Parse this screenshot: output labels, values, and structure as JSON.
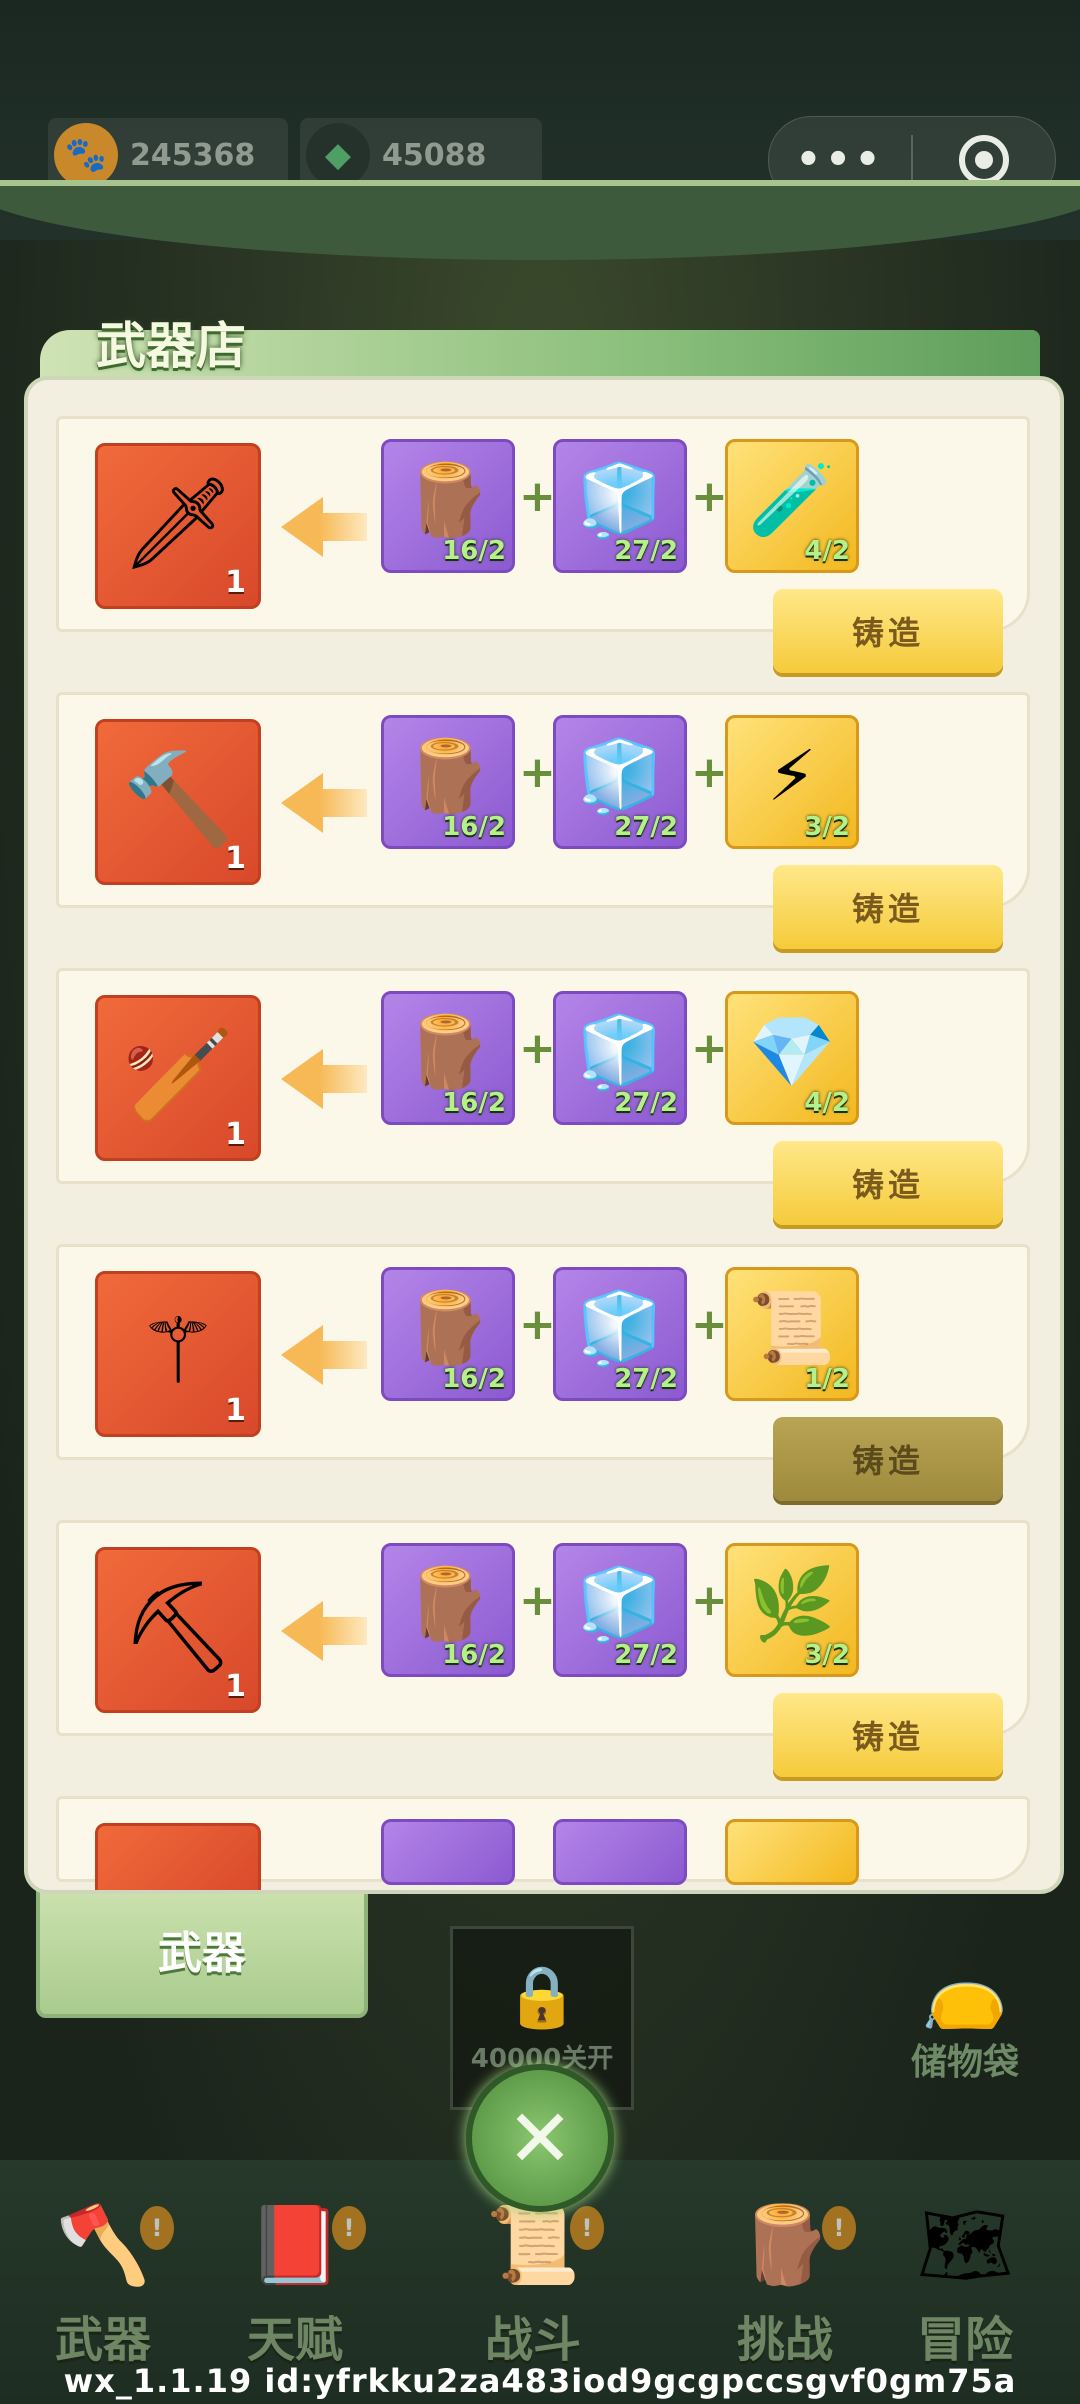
{
  "header": {
    "coins": "245368",
    "gems": "45088",
    "more_icon": "more-dots-icon",
    "record_icon": "target-icon"
  },
  "shop": {
    "title": "武器店",
    "items": [
      {
        "weapon_icon": "jade-blade-icon",
        "count": "1",
        "materials": [
          "16/2",
          "27/2",
          "4/2"
        ],
        "mat3_icon": "red-potion-icon",
        "forge_label": "铸造",
        "forge_enabled": true
      },
      {
        "weapon_icon": "hammer-icon",
        "count": "1",
        "materials": [
          "16/2",
          "27/2",
          "3/2"
        ],
        "mat3_icon": "thunder-log-icon",
        "forge_label": "铸造",
        "forge_enabled": true
      },
      {
        "weapon_icon": "mace-icon",
        "count": "1",
        "materials": [
          "16/2",
          "27/2",
          "4/2"
        ],
        "mat3_icon": "green-crystal-icon",
        "forge_label": "铸造",
        "forge_enabled": true
      },
      {
        "weapon_icon": "golden-staff-icon",
        "count": "1",
        "materials": [
          "16/2",
          "27/2",
          "1/2"
        ],
        "mat3_icon": "scroll-icon",
        "forge_label": "铸造",
        "forge_enabled": false
      },
      {
        "weapon_icon": "rake-icon",
        "count": "1",
        "materials": [
          "16/2",
          "27/2",
          "3/2"
        ],
        "mat3_icon": "herb-icon",
        "forge_label": "铸造",
        "forge_enabled": true
      }
    ]
  },
  "tabs": {
    "weapon_tab": "武器",
    "lock_text": "40000关开",
    "bag_label": "储物袋"
  },
  "nav": {
    "items": [
      {
        "label": "武器",
        "icon": "axe-icon",
        "badge": "!"
      },
      {
        "label": "天赋",
        "icon": "book-icon",
        "badge": "!"
      },
      {
        "label": "战斗",
        "icon": "scroll-icon",
        "badge": "!"
      },
      {
        "label": "挑战",
        "icon": "totem-icon",
        "badge": "!"
      },
      {
        "label": "冒险",
        "icon": "map-icon",
        "badge": ""
      }
    ]
  },
  "footer": {
    "text": "wx_1.1.19 id:yfrkku2za483iod9gcgpccsgvf0gm75a"
  },
  "colors": {
    "panel_bg": "#f3efe0",
    "forge_button": "#f5cb3a",
    "weapon_box": "#e0552f",
    "material_purple": "#9f6fdc",
    "material_gold": "#f6c83a"
  }
}
